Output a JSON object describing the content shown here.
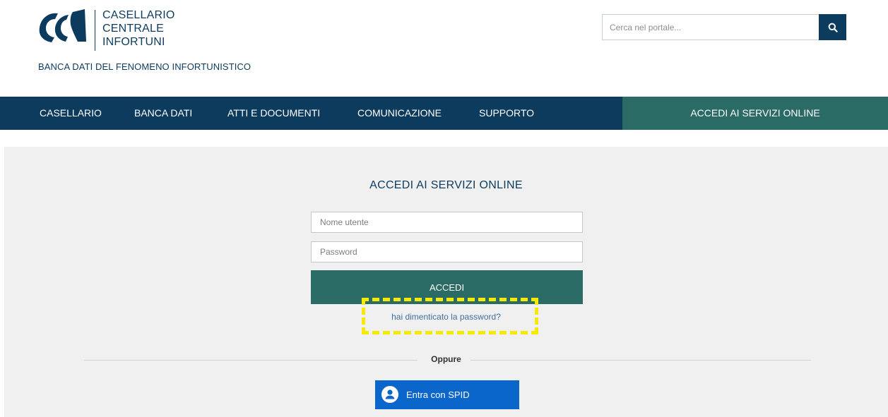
{
  "header": {
    "logo_lines": [
      "CASELLARIO",
      "CENTRALE",
      "INFORTUNI"
    ],
    "tagline": "BANCA DATI DEL FENOMENO INFORTUNISTICO",
    "search": {
      "placeholder": "Cerca nel portale...",
      "value": "",
      "button_icon": "search-icon"
    }
  },
  "nav": {
    "items": [
      "CASELLARIO",
      "BANCA DATI",
      "ATTI E DOCUMENTI",
      "COMUNICAZIONE",
      "SUPPORTO"
    ],
    "cta": "ACCEDI AI SERVIZI ONLINE"
  },
  "login": {
    "title": "ACCEDI AI SERVIZI ONLINE",
    "username_placeholder": "Nome utente",
    "password_placeholder": "Password",
    "submit_label": "ACCEDI",
    "forgot_link": "hai dimenticato la password?",
    "separator": "Oppure",
    "spid_label": "Entra con SPID",
    "spid_icon": "user-icon"
  },
  "colors": {
    "navy": "#0d3b5e",
    "teal": "#2b6b66",
    "spid_blue": "#0b66cc",
    "highlight": "#f5ea00"
  }
}
